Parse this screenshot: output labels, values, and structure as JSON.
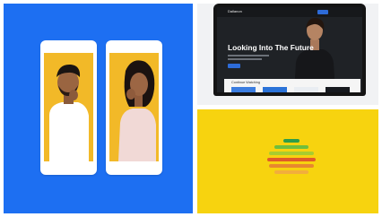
{
  "left_panel": {
    "background": "#1d6ff2",
    "phones": [
      {
        "screen_color": "#f2b928"
      },
      {
        "screen_color": "#f2b928"
      }
    ]
  },
  "laptop_panel": {
    "brand": "Dallanon",
    "hero_title": "Looking Into The Future",
    "row_title": "Continue Watching",
    "thumb_colors": [
      "#3b7de0",
      "#2b73d8",
      "#e9edf2",
      "#171a1f"
    ]
  },
  "yellow_panel": {
    "background": "#f7d30f",
    "stripe_colors": [
      "#2e9d4a",
      "#6fbe3e",
      "#a8cc2f",
      "#e05a2a",
      "#e8892e",
      "#f2ae3c"
    ]
  }
}
